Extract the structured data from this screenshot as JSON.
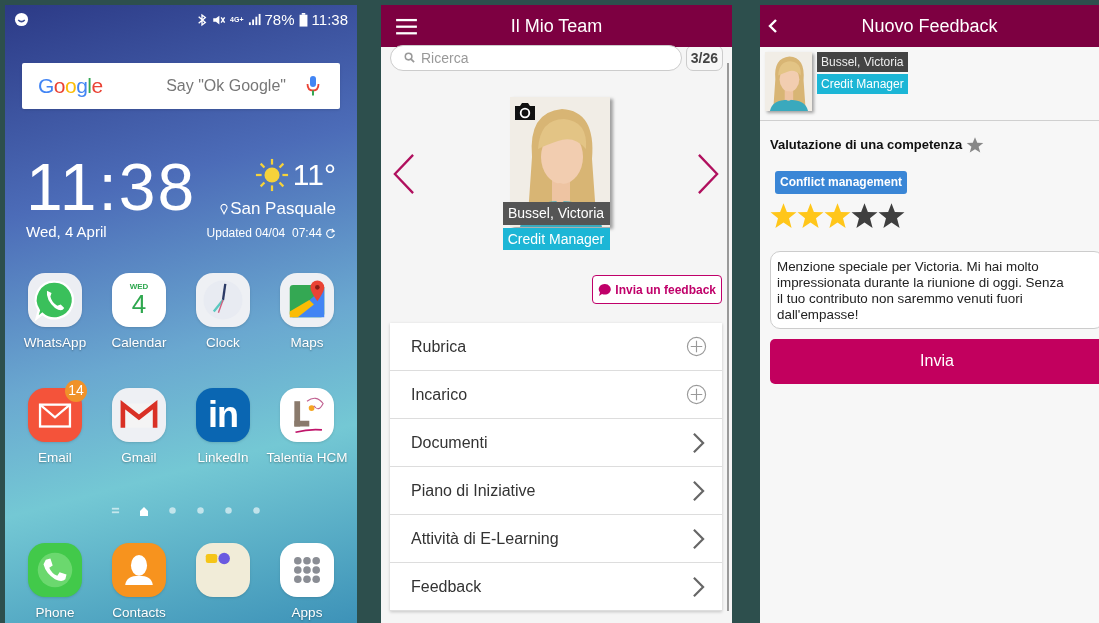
{
  "home_screen": {
    "status_bar": {
      "network": "4G+",
      "battery": "78%",
      "time": "11:38"
    },
    "search": {
      "logo": "Google",
      "placeholder": "Say \"Ok Google\""
    },
    "clock": {
      "time": "11:38",
      "date": "Wed, 4 April"
    },
    "weather": {
      "temperature": "11°",
      "location": "San Pasquale",
      "updated": "Updated 04/04  07:44"
    },
    "apps": [
      {
        "label": "WhatsApp",
        "kind": "whatsapp"
      },
      {
        "label": "Calendar",
        "kind": "calendar",
        "icon_text": [
          "WED",
          "4"
        ]
      },
      {
        "label": "Clock",
        "kind": "clock"
      },
      {
        "label": "Maps",
        "kind": "maps"
      },
      {
        "label": "Email",
        "kind": "email",
        "badge": "14"
      },
      {
        "label": "Gmail",
        "kind": "gmail"
      },
      {
        "label": "LinkedIn",
        "kind": "linkedin",
        "icon_text": [
          "in"
        ]
      },
      {
        "label": "Talentia HCM",
        "kind": "talentia"
      }
    ],
    "page_indicators": [
      {
        "kind": "menu",
        "selected": false
      },
      {
        "kind": "home",
        "selected": true
      },
      {
        "kind": "dot",
        "selected": false
      },
      {
        "kind": "dot",
        "selected": false
      },
      {
        "kind": "dot",
        "selected": false
      },
      {
        "kind": "dot",
        "selected": false
      }
    ],
    "dock": [
      {
        "label": "Phone",
        "kind": "phone"
      },
      {
        "label": "Contacts",
        "kind": "contacts"
      },
      {
        "kind": "folder"
      },
      {
        "label": "Apps",
        "kind": "apps"
      }
    ]
  },
  "team_screen": {
    "title": "Il Mio Team",
    "search": {
      "placeholder": "Ricerca",
      "counter": "3/26"
    },
    "profile": {
      "name": "Bussel, Victoria",
      "role": "Credit Manager"
    },
    "feedback_button": "Invia un feedback",
    "menu": [
      {
        "label": "Rubrica",
        "kind": "add"
      },
      {
        "label": "Incarico",
        "kind": "add"
      },
      {
        "label": "Documenti",
        "kind": "open"
      },
      {
        "label": "Piano di Iniziative",
        "kind": "open"
      },
      {
        "label": "Attività di E-Learning",
        "kind": "open"
      },
      {
        "label": "Feedback",
        "kind": "open"
      }
    ]
  },
  "feedback_screen": {
    "title": "Nuovo Feedback",
    "profile": {
      "name": "Bussel, Victoria",
      "role": "Credit Manager"
    },
    "section_title": "Valutazione di una competenza",
    "competency": "Conflict management",
    "rating": {
      "stars": 3
    },
    "comment": "Menzione speciale per Victoria. Mi hai molto impressionata durante la riunione di oggi. Senza il tuo contributo non saremmo venuti fuori dall'empasse!",
    "send_button": "Invia"
  }
}
